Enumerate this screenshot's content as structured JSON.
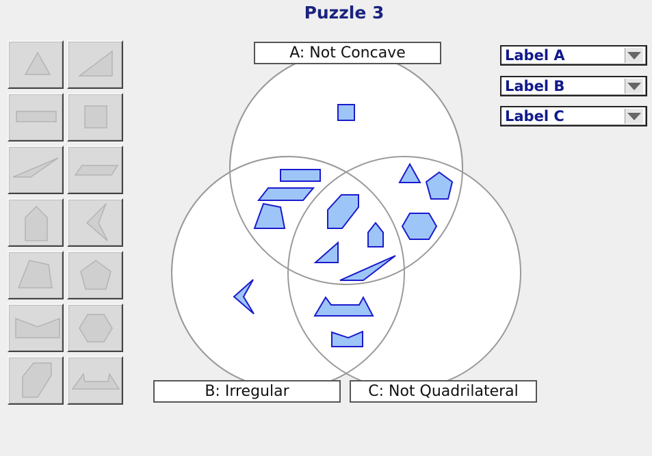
{
  "page": {
    "title": "Puzzle 3"
  },
  "sets": {
    "a": {
      "label": "A: Not Concave"
    },
    "b": {
      "label": "B: Irregular"
    },
    "c": {
      "label": "C: Not Quadrilateral"
    }
  },
  "dropdowns": [
    {
      "label": "Label A"
    },
    {
      "label": "Label B"
    },
    {
      "label": "Label C"
    }
  ],
  "palette": {
    "shapes": [
      "triangle-icon",
      "right-triangle-icon",
      "rectangle-icon",
      "square-icon",
      "thin-triangle-icon",
      "parallelogram-icon",
      "pentagon-house-icon",
      "arrowhead-icon",
      "irregular-quadrilateral-icon",
      "regular-pentagon-icon",
      "concave-pentagon-icon",
      "regular-hexagon-icon",
      "irregular-hexagon-icon",
      "concave-octagon-icon"
    ]
  },
  "colors": {
    "shape_fill": "#9ec5f7",
    "shape_stroke": "#1a1acd",
    "title": "#1a237e"
  }
}
